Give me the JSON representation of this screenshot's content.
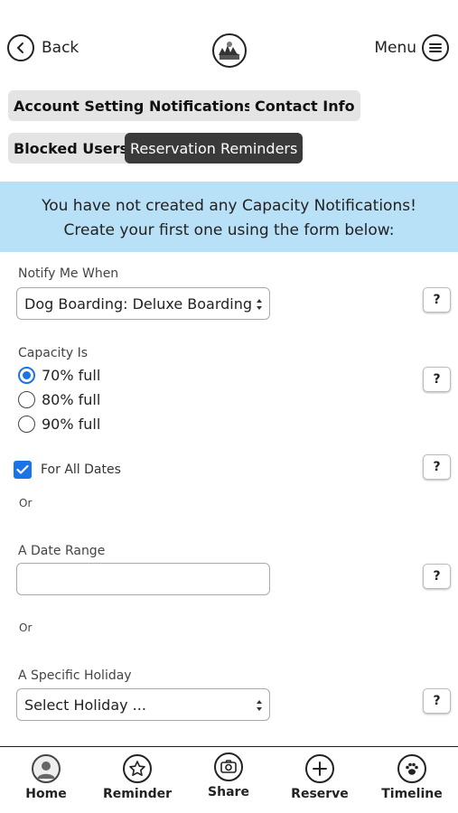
{
  "header": {
    "back_label": "Back",
    "menu_label": "Menu"
  },
  "tabs": [
    {
      "label": "Account Settings",
      "active": false
    },
    {
      "label": "Notifications",
      "active": false
    },
    {
      "label": "Contact Info",
      "active": false
    },
    {
      "label": "Blocked Users",
      "active": false
    },
    {
      "label": "Reservation Reminders",
      "active": true
    }
  ],
  "banner": {
    "line1": "You have not created any Capacity Notifications!",
    "line2": "Create your first one using the form below:"
  },
  "form": {
    "notify_label": "Notify Me When",
    "notify_value": "Dog Boarding: Deluxe Boarding",
    "capacity_label": "Capacity Is",
    "capacity_options": [
      {
        "label": "70% full",
        "selected": true
      },
      {
        "label": "80% full",
        "selected": false
      },
      {
        "label": "90% full",
        "selected": false
      }
    ],
    "all_dates_label": "For All Dates",
    "all_dates_checked": true,
    "or_text": "Or",
    "date_range_label": "A Date Range",
    "date_range_value": "",
    "holiday_label": "A Specific Holiday",
    "holiday_value": "Select Holiday ...",
    "help_label": "?"
  },
  "bottom_nav": [
    {
      "label": "Home",
      "icon": "avatar-icon"
    },
    {
      "label": "Reminder",
      "icon": "star-icon"
    },
    {
      "label": "Share",
      "icon": "camera-icon"
    },
    {
      "label": "Reserve",
      "icon": "plus-icon"
    },
    {
      "label": "Timeline",
      "icon": "paw-icon"
    }
  ],
  "colors": {
    "accent": "#1a73e8",
    "banner": "#b8e0f7",
    "active_tab": "#3a3a3a",
    "tab": "#e4e4e4"
  }
}
